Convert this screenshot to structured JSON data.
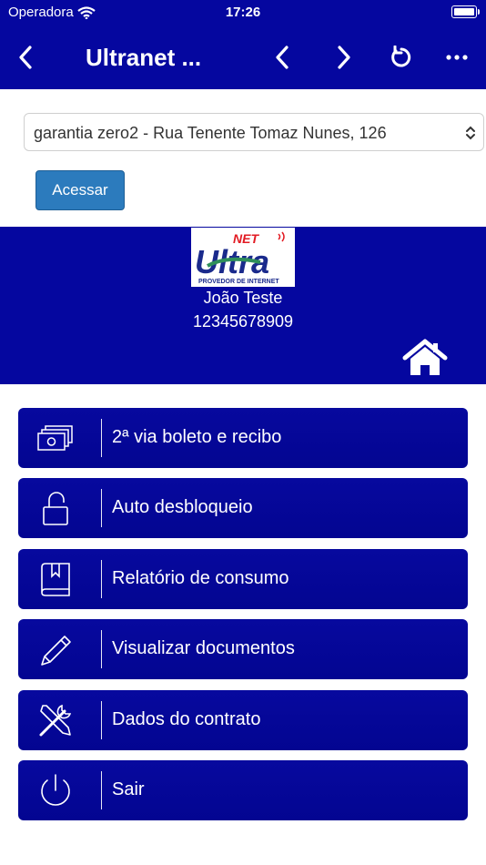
{
  "status_bar": {
    "carrier": "Operadora",
    "time": "17:26"
  },
  "navbar": {
    "title": "Ultranet ..."
  },
  "location_select": {
    "value": "garantia zero2 - Rua Tenente Tomaz Nunes, 126"
  },
  "access_button": {
    "label": "Acessar"
  },
  "profile": {
    "logo": {
      "top": "NET",
      "main": "Ultra",
      "tagline": "PROVEDOR DE INTERNET"
    },
    "name": "João Teste",
    "document": "12345678909"
  },
  "menu": [
    {
      "label": "2ª via boleto e recibo",
      "icon": "money-bills-icon"
    },
    {
      "label": "Auto desbloqueio",
      "icon": "unlock-icon"
    },
    {
      "label": "Relatório de consumo",
      "icon": "book-icon"
    },
    {
      "label": "Visualizar documentos",
      "icon": "pencil-icon"
    },
    {
      "label": "Dados do contrato",
      "icon": "tools-icon"
    },
    {
      "label": "Sair",
      "icon": "power-icon"
    }
  ],
  "colors": {
    "primary": "#05079f",
    "button": "#2c7bbd"
  }
}
